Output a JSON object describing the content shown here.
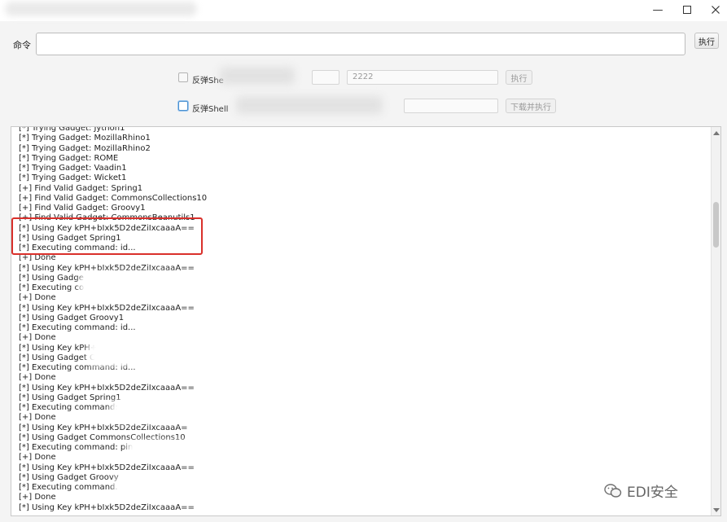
{
  "window": {
    "minimize_glyph": "—",
    "controls": [
      "minimize-icon",
      "maximize-icon",
      "close-icon"
    ]
  },
  "command": {
    "label": "命令",
    "input_value": "",
    "execute_button": "执行"
  },
  "reverse_shell_1": {
    "checkbox_label": "反弹She",
    "checked": false,
    "port_value": "2222",
    "execute_button": "执行"
  },
  "reverse_shell_2": {
    "checkbox_label": "反弹Shell",
    "checked": false,
    "download_button": "下载并执行"
  },
  "console": {
    "lines": [
      "[*] Trying Gadget: Jython1",
      "[*] Trying Gadget: MozillaRhino1",
      "[*] Trying Gadget: MozillaRhino2",
      "[*] Trying Gadget: ROME",
      "[*] Trying Gadget: Vaadin1",
      "[*] Trying Gadget: Wicket1",
      "[+] Find Valid Gadget: Spring1",
      "[+] Find Valid Gadget: CommonsCollections10",
      "[+] Find Valid Gadget: Groovy1",
      "[+] Find Valid Gadget: CommonsBeanutils1",
      "[*] Using Key kPH+bIxk5D2deZiIxcaaaA==",
      "[*] Using Gadget Spring1",
      "[*] Executing command: id...",
      "[+] Done",
      "[*] Using Key kPH+bIxk5D2deZiIxcaaaA==",
      "[*] Using Gadge",
      "[*] Executing co",
      "[+] Done",
      "[*] Using Key kPH+bIxk5D2deZiIxcaaaA==",
      "[*] Using Gadget Groovy1",
      "[*] Executing command: id...",
      "[+] Done",
      "[*] Using Key kPH+",
      "[*] Using Gadget C",
      "[*] Executing command: id...",
      "[+] Done",
      "[*] Using Key kPH+bIxk5D2deZiIxcaaaA==",
      "[*] Using Gadget Spring1",
      "[*] Executing command:",
      "[+] Done",
      "[*] Using Key kPH+bIxk5D2deZiIxcaaaA=",
      "[*] Using Gadget CommonsCollections10",
      "[*] Executing command: pin",
      "[+] Done",
      "[*] Using Key kPH+bIxk5D2deZiIxcaaaA==",
      "[*] Using Gadget Groovy",
      "[*] Executing command.",
      "[+] Done",
      "[*] Using Key kPH+bIxk5D2deZiIxcaaaA=="
    ]
  },
  "watermark": {
    "text": "EDI安全",
    "icon": "wechat-icon"
  },
  "colors": {
    "highlight_border": "#d9302b",
    "focus_blue": "#4a90d0"
  }
}
